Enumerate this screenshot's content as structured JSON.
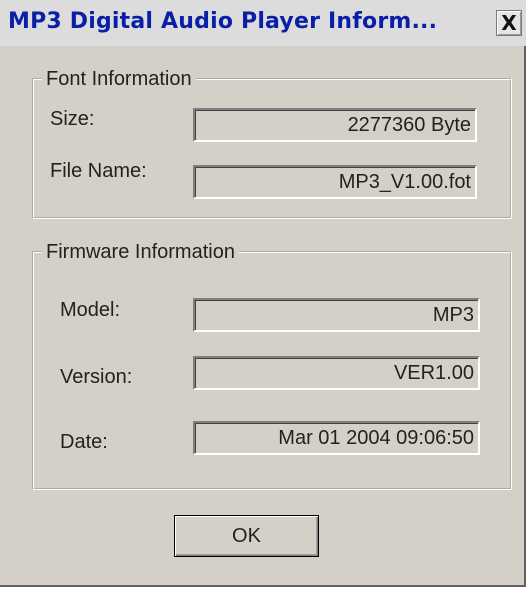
{
  "window": {
    "title": "MP3 Digital Audio Player Inform...",
    "close_label": "X"
  },
  "font_info": {
    "legend": "Font Information",
    "size_label": "Size:",
    "size_value": "2277360 Byte",
    "filename_label": "File Name:",
    "filename_value": "MP3_V1.00.fot"
  },
  "firmware_info": {
    "legend": "Firmware Information",
    "model_label": "Model:",
    "model_value": "MP3",
    "version_label": "Version:",
    "version_value": "VER1.00",
    "date_label": "Date:",
    "date_value": "Mar 01 2004 09:06:50"
  },
  "buttons": {
    "ok_label": "OK"
  }
}
